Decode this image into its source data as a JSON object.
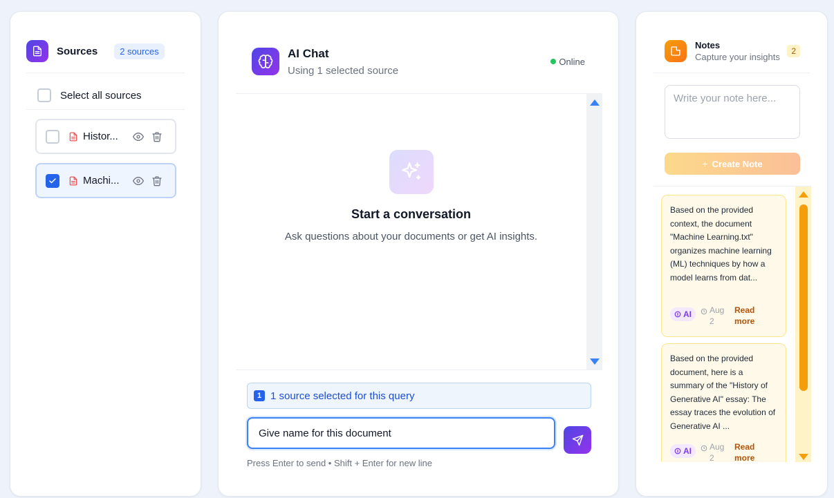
{
  "sources": {
    "title": "Sources",
    "count_badge": "2 sources",
    "select_all_label": "Select all sources",
    "items": [
      {
        "name": "Histor...",
        "checked": false
      },
      {
        "name": "Machi...",
        "checked": true
      }
    ],
    "icons": {
      "header": "document-icon",
      "file": "file-text-icon",
      "view": "eye-icon",
      "delete": "trash-icon"
    }
  },
  "chat": {
    "title": "AI Chat",
    "subtitle": "Using 1 selected source",
    "status": "Online",
    "empty_title": "Start a conversation",
    "empty_subtitle": "Ask questions about your documents or get AI insights.",
    "selected_count": "1",
    "selected_text": "1 source selected for this query",
    "input_value": "Give name for this document",
    "hint": "Press Enter to send • Shift + Enter for new line",
    "icons": {
      "header": "brain-icon",
      "empty": "sparkles-icon",
      "send": "send-icon"
    }
  },
  "notes": {
    "title": "Notes",
    "subtitle": "Capture your insights",
    "count": "2",
    "placeholder": "Write your note here...",
    "create_label": "Create Note",
    "items": [
      {
        "text": "Based on the provided context, the document \"Machine Learning.txt\" organizes machine learning (ML) techniques by how a model learns from dat...",
        "badge": "AI",
        "date": "Aug 2",
        "action": "Read more"
      },
      {
        "text": "Based on the provided document, here is a summary of the \"History of Generative AI\" essay: The essay traces the evolution of Generative AI ...",
        "badge": "AI",
        "date": "Aug 2",
        "action": "Read more"
      }
    ],
    "icons": {
      "header": "note-icon",
      "clock": "clock-icon"
    }
  },
  "colors": {
    "accent": "#2563eb",
    "brand_gradient_start": "#4f46e5",
    "brand_gradient_end": "#9333ea",
    "notes_accent": "#f59e0b",
    "online": "#22c55e"
  }
}
